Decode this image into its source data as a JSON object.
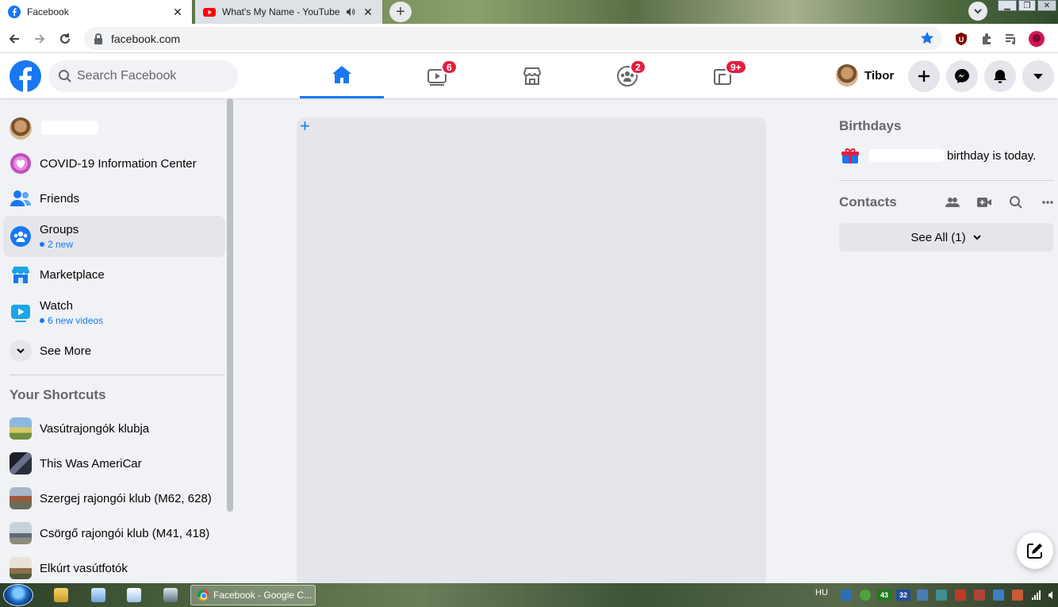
{
  "browser": {
    "tabs": [
      {
        "title": "Facebook",
        "active": true
      },
      {
        "title": "What's My Name - YouTube",
        "active": false,
        "audio": true
      }
    ],
    "address": "facebook.com"
  },
  "fb": {
    "search_placeholder": "Search Facebook",
    "nav": [
      {
        "name": "home",
        "badge": ""
      },
      {
        "name": "watch",
        "badge": "6"
      },
      {
        "name": "marketplace",
        "badge": ""
      },
      {
        "name": "groups",
        "badge": "2"
      },
      {
        "name": "gaming",
        "badge": "9+"
      }
    ],
    "profile_name": "Tibor"
  },
  "sidebar": {
    "items": [
      {
        "label": "COVID-19 Information Center"
      },
      {
        "label": "Friends"
      },
      {
        "label": "Groups",
        "sub": "2 new"
      },
      {
        "label": "Marketplace"
      },
      {
        "label": "Watch",
        "sub": "6 new videos"
      },
      {
        "label": "See More"
      }
    ],
    "shortcuts_heading": "Your Shortcuts",
    "shortcuts": [
      {
        "label": "Vasútrajongók klubja"
      },
      {
        "label": "This Was AmeriCar"
      },
      {
        "label": "Szergej rajongói klub (M62, 628)"
      },
      {
        "label": "Csörgő rajongói klub (M41, 418)"
      },
      {
        "label": "Elkúrt vasútfotók"
      }
    ]
  },
  "right": {
    "birthdays_heading": "Birthdays",
    "birthday_text": "birthday is today.",
    "contacts_heading": "Contacts",
    "see_all_label": "See All (1)"
  },
  "taskbar": {
    "task_title": "Facebook - Google C...",
    "lang": "HU",
    "tray_numbers": [
      "43",
      "32"
    ]
  },
  "colors": {
    "fb_blue": "#1877f2",
    "badge_red": "#e41e3f",
    "page_bg": "#f0f2f5"
  }
}
